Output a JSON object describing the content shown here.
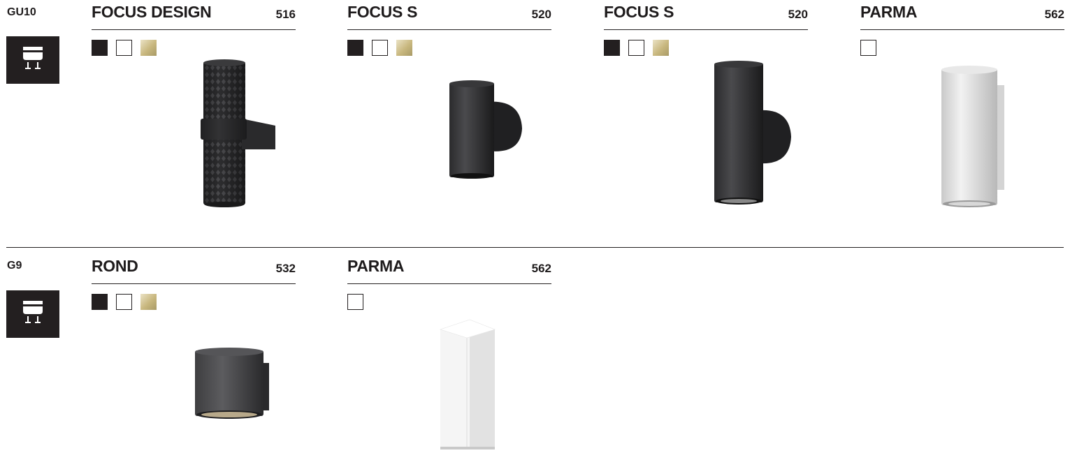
{
  "sections": [
    {
      "socket": "GU10",
      "icon": "lamp-socket-icon",
      "products": [
        {
          "name": "FOCUS DESIGN",
          "number": "516",
          "colors": [
            "black",
            "white",
            "gold"
          ],
          "image": "focus-design-double-wall-lamp"
        },
        {
          "name": "FOCUS S",
          "number": "520",
          "colors": [
            "black",
            "white",
            "gold"
          ],
          "image": "focus-s-single-wall-lamp"
        },
        {
          "name": "FOCUS S",
          "number": "520",
          "colors": [
            "black",
            "white",
            "gold"
          ],
          "image": "focus-s-tall-wall-lamp"
        },
        {
          "name": "PARMA",
          "number": "562",
          "colors": [
            "white"
          ],
          "image": "parma-round-wall-lamp"
        }
      ]
    },
    {
      "socket": "G9",
      "icon": "lamp-socket-icon",
      "products": [
        {
          "name": "ROND",
          "number": "532",
          "colors": [
            "black",
            "white",
            "gold"
          ],
          "image": "rond-wall-lamp"
        },
        {
          "name": "PARMA",
          "number": "562",
          "colors": [
            "white"
          ],
          "image": "parma-square-wall-lamp"
        }
      ]
    }
  ],
  "swatch_colors": {
    "black": "#231f20",
    "white": "#ffffff",
    "gold": "#cbbb85"
  }
}
